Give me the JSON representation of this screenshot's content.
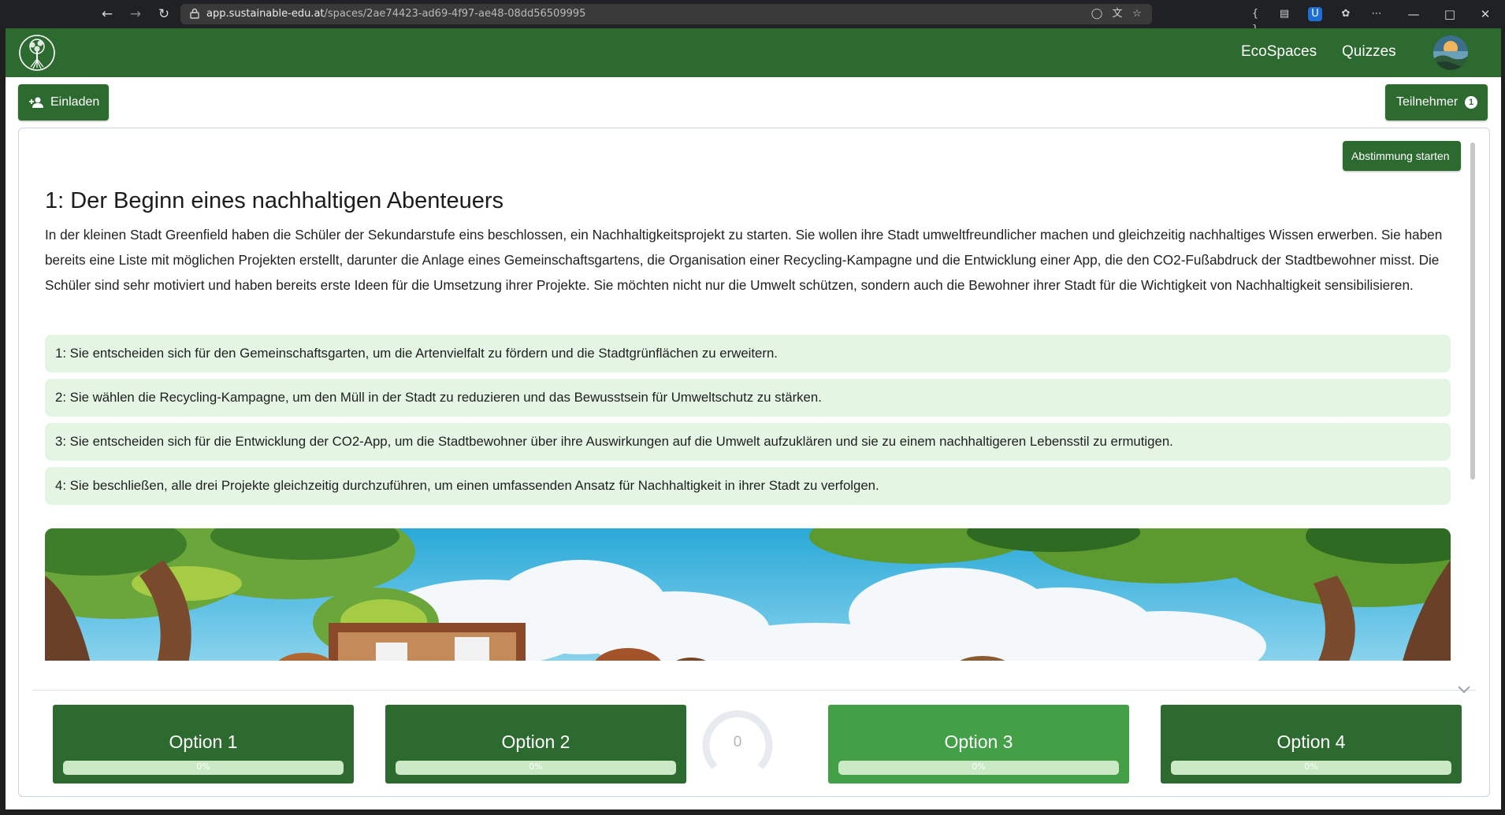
{
  "browser": {
    "url_host": "app.sustainable-edu.at",
    "url_path": "/spaces/2ae74423-ad69-4f97-ae48-08dd56509995"
  },
  "header": {
    "nav": [
      "EcoSpaces",
      "Quizzes"
    ]
  },
  "toolbar": {
    "invite_label": "Einladen",
    "participants_label": "Teilnehmer",
    "participants_count": "1"
  },
  "story": {
    "start_vote_label": "Abstimmung starten",
    "title": "1: Der Beginn eines nachhaltigen Abenteuers",
    "text": "In der kleinen Stadt Greenfield haben die Schüler der Sekundarstufe eins beschlossen, ein Nachhaltigkeitsprojekt zu starten. Sie wollen ihre Stadt umweltfreundlicher machen und gleichzeitig nachhaltiges Wissen erwerben. Sie haben bereits eine Liste mit möglichen Projekten erstellt, darunter die Anlage eines Gemeinschaftsgartens, die Organisation einer Recycling-Kampagne und die Entwicklung einer App, die den CO2-Fußabdruck der Stadtbewohner misst. Die Schüler sind sehr motiviert und haben bereits erste Ideen für die Umsetzung ihrer Projekte. Sie möchten nicht nur die Umwelt schützen, sondern auch die Bewohner ihrer Stadt für die Wichtigkeit von Nachhaltigkeit sensibilisieren.",
    "choices": [
      "1: Sie entscheiden sich für den Gemeinschaftsgarten, um die Artenvielfalt zu fördern und die Stadtgrünflächen zu erweitern.",
      "2: Sie wählen die Recycling-Kampagne, um den Müll in der Stadt zu reduzieren und das Bewusstsein für Umweltschutz zu stärken.",
      "3: Sie entscheiden sich für die Entwicklung der CO2-App, um die Stadtbewohner über ihre Auswirkungen auf die Umwelt aufzuklären und sie zu einem nachhaltigeren Lebensstil zu ermutigen.",
      "4: Sie beschließen, alle drei Projekte gleichzeitig durchzuführen, um einen umfassenden Ansatz für Nachhaltigkeit in ihrer Stadt zu verfolgen."
    ]
  },
  "voting": {
    "timer_value": "0",
    "options": [
      {
        "label": "Option 1",
        "percent_text": "0%",
        "fraction": 0,
        "color": "#2d6a2f"
      },
      {
        "label": "Option 2",
        "percent_text": "0%",
        "fraction": 0,
        "color": "#2d6a2f"
      },
      {
        "label": "Option 3",
        "percent_text": "0%",
        "fraction": 0,
        "color": "#43a047"
      },
      {
        "label": "Option 4",
        "percent_text": "0%",
        "fraction": 0,
        "color": "#2d6a2f"
      }
    ]
  },
  "theme": {
    "primary": "#2d6a2f",
    "choice_bg": "#e4f5e4"
  }
}
